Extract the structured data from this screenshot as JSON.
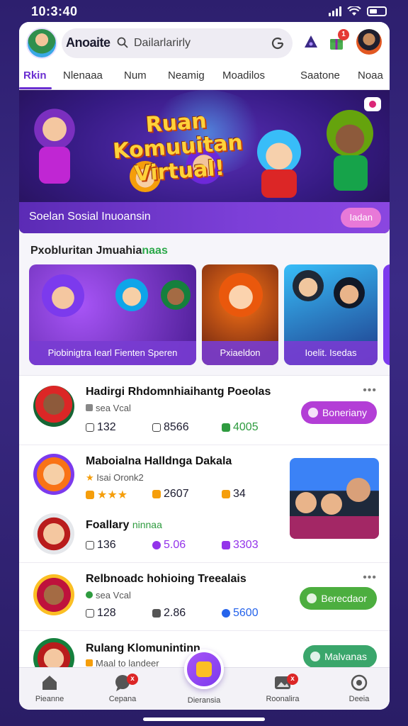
{
  "status_bar": {
    "time": "10:3:40"
  },
  "header": {
    "app_title": "Anoaite",
    "search_placeholder": "Dailarlarirly",
    "notification_count": "1"
  },
  "tabs": [
    {
      "label": "Rkin"
    },
    {
      "label": "Nlenaaa"
    },
    {
      "label": "Num"
    },
    {
      "label": "Neamig"
    },
    {
      "label": "Moadilos"
    },
    {
      "label": "Saatone"
    },
    {
      "label": "Noaa"
    }
  ],
  "hero": {
    "title": "Ruan Komuuitan Virtual!",
    "subtitle": "Soelan Sosial Inuoansin",
    "button_label": "Iadan"
  },
  "section": {
    "title_main": "Pxobluritan Jmuahia",
    "title_highlight": "naas",
    "tiles": [
      {
        "caption": "Piobinigtra Iearl Fienten Speren"
      },
      {
        "caption": "Pxiaeldon"
      },
      {
        "caption": "Ioelit. Isedas"
      }
    ]
  },
  "feed": {
    "posts": [
      {
        "name": "Hadirgi Rhdomnhiaihantg Poeolas",
        "meta": "sea Vcal",
        "stats": [
          "132",
          "8566",
          "4005"
        ],
        "action": "Boneriany",
        "action_color": "#b33ed6"
      },
      {
        "name": "Maboialna Halldnga Dakala",
        "meta": "Isai Oronk2",
        "stats": [
          "★★★",
          "2607",
          "34"
        ],
        "action": ""
      },
      {
        "name": "Foallary",
        "name_highlight": "ninnaa",
        "meta": "",
        "stats": [
          "136",
          "5.06",
          "3303"
        ],
        "action": ""
      },
      {
        "name": "Relbnoadc hohioing Treealais",
        "meta": "sea Vcal",
        "stats": [
          "128",
          "2.86",
          "5600"
        ],
        "action": "Berecdaor",
        "action_color": "#4cae3f"
      },
      {
        "name": "Rulang Klomunintinn",
        "meta": "Maal to landeer",
        "stats": [],
        "action": "Malvanas",
        "action_color": "#3aa66b"
      }
    ]
  },
  "bottom_nav": [
    {
      "label": "Pieanne",
      "icon": "home-icon"
    },
    {
      "label": "Cepana",
      "icon": "chat-icon",
      "badge": "x"
    },
    {
      "label": "Dieransia",
      "icon": "create-icon"
    },
    {
      "label": "Roonalira",
      "icon": "gallery-icon",
      "badge": "x"
    },
    {
      "label": "Deeia",
      "icon": "profile-icon"
    }
  ],
  "colors": {
    "accent": "#6a2fd1",
    "hero_bg": "#351a82",
    "title_yellow": "#ffd23a"
  }
}
